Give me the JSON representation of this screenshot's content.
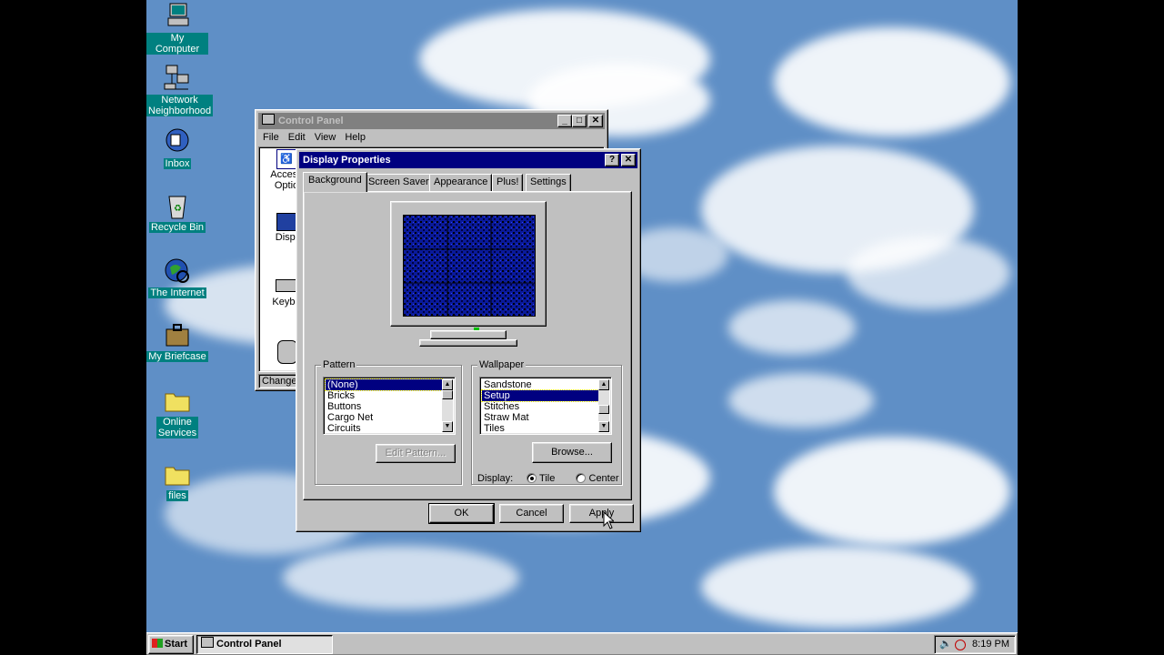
{
  "desktop": {
    "icons": [
      {
        "label": "My Computer",
        "icon": "my-computer-icon"
      },
      {
        "label": "Network\nNeighborhood",
        "icon": "network-neighborhood-icon"
      },
      {
        "label": "Inbox",
        "icon": "inbox-icon"
      },
      {
        "label": "Recycle Bin",
        "icon": "recycle-bin-icon"
      },
      {
        "label": "The Internet",
        "icon": "internet-icon"
      },
      {
        "label": "My Briefcase",
        "icon": "briefcase-icon"
      },
      {
        "label": "Online\nServices",
        "icon": "folder-icon"
      },
      {
        "label": "files",
        "icon": "folder-icon"
      }
    ]
  },
  "control_panel": {
    "title": "Control Panel",
    "menu": [
      "File",
      "Edit",
      "View",
      "Help"
    ],
    "items": [
      "Access\nOptio",
      "Displ",
      "Keybo"
    ],
    "status": "Changes"
  },
  "display_properties": {
    "title": "Display Properties",
    "tabs": [
      "Background",
      "Screen Saver",
      "Appearance",
      "Plus!",
      "Settings"
    ],
    "active_tab": "Background",
    "pattern": {
      "label": "Pattern",
      "items": [
        "(None)",
        "Bricks",
        "Buttons",
        "Cargo Net",
        "Circuits"
      ],
      "selected": "(None)",
      "edit_button": "Edit Pattern..."
    },
    "wallpaper": {
      "label": "Wallpaper",
      "items": [
        "Sandstone",
        "Setup",
        "Stitches",
        "Straw Mat",
        "Tiles"
      ],
      "selected": "Setup",
      "browse_button": "Browse...",
      "display_label": "Display:",
      "options": [
        "Tile",
        "Center"
      ],
      "selected_option": "Tile"
    },
    "buttons": {
      "ok": "OK",
      "cancel": "Cancel",
      "apply": "Apply"
    }
  },
  "taskbar": {
    "start": "Start",
    "task": "Control Panel",
    "clock": "8:19 PM"
  },
  "colors": {
    "title_active": "#000080",
    "face": "#c0c0c0",
    "desktop_label": "#008080",
    "sky": "#5f8fc6"
  }
}
